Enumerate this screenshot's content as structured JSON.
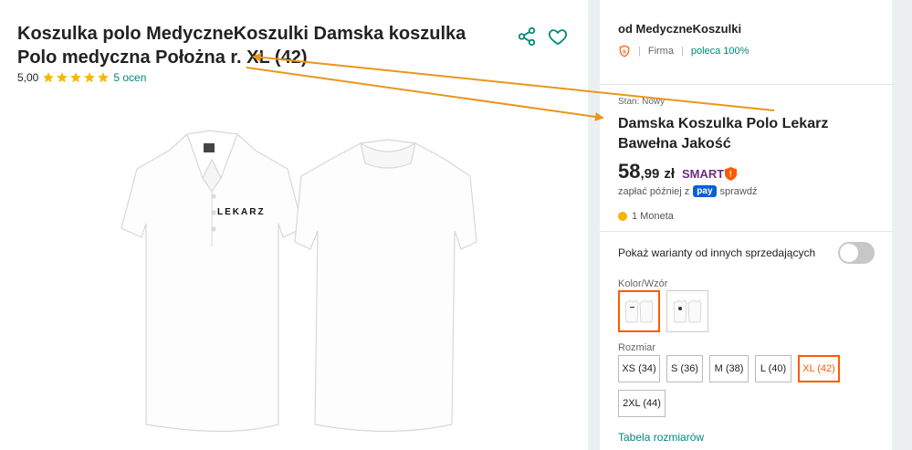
{
  "product": {
    "title": "Koszulka polo MedyczneKoszulki Damska koszulka Polo medyczna Położna r. XL (42)",
    "rating_value": "5,00",
    "stars": 5,
    "reviews_count": "5 ocen",
    "image_text": "LEKARZ"
  },
  "icons": {
    "share": "share-icon",
    "favorite": "heart-icon",
    "star": "star-icon",
    "smart": "smart-icon",
    "coin": "coin-icon"
  },
  "seller": {
    "name": "od MedyczneKoszulki",
    "type": "Firma",
    "recommend": "poleca 100%"
  },
  "offer": {
    "condition": "Stan: Nowy",
    "title": "Damska Koszulka Polo Lekarz Bawełna Jakość",
    "price_int": "58",
    "price_dec": ",99",
    "currency": "zł",
    "smart_label": "SMART",
    "paylater_prefix": "zapłać później z",
    "pay_label": "pay",
    "paylater_suffix": "sprawdź",
    "coins": "1 Moneta"
  },
  "variants": {
    "toggle_label": "Pokaż warianty od innych sprzedających",
    "toggle_on": false,
    "color_label": "Kolor/Wzór",
    "size_label": "Rozmiar",
    "sizes": [
      "XS (34)",
      "S (36)",
      "M (38)",
      "L (40)",
      "XL (42)",
      "2XL (44)"
    ],
    "selected_size": "XL (42)",
    "size_chart": "Tabela rozmiarów"
  },
  "colors": {
    "accent": "#ff5a00",
    "link": "#00897b",
    "annotation_arrow": "#e8961e",
    "star": "#f5b800"
  }
}
